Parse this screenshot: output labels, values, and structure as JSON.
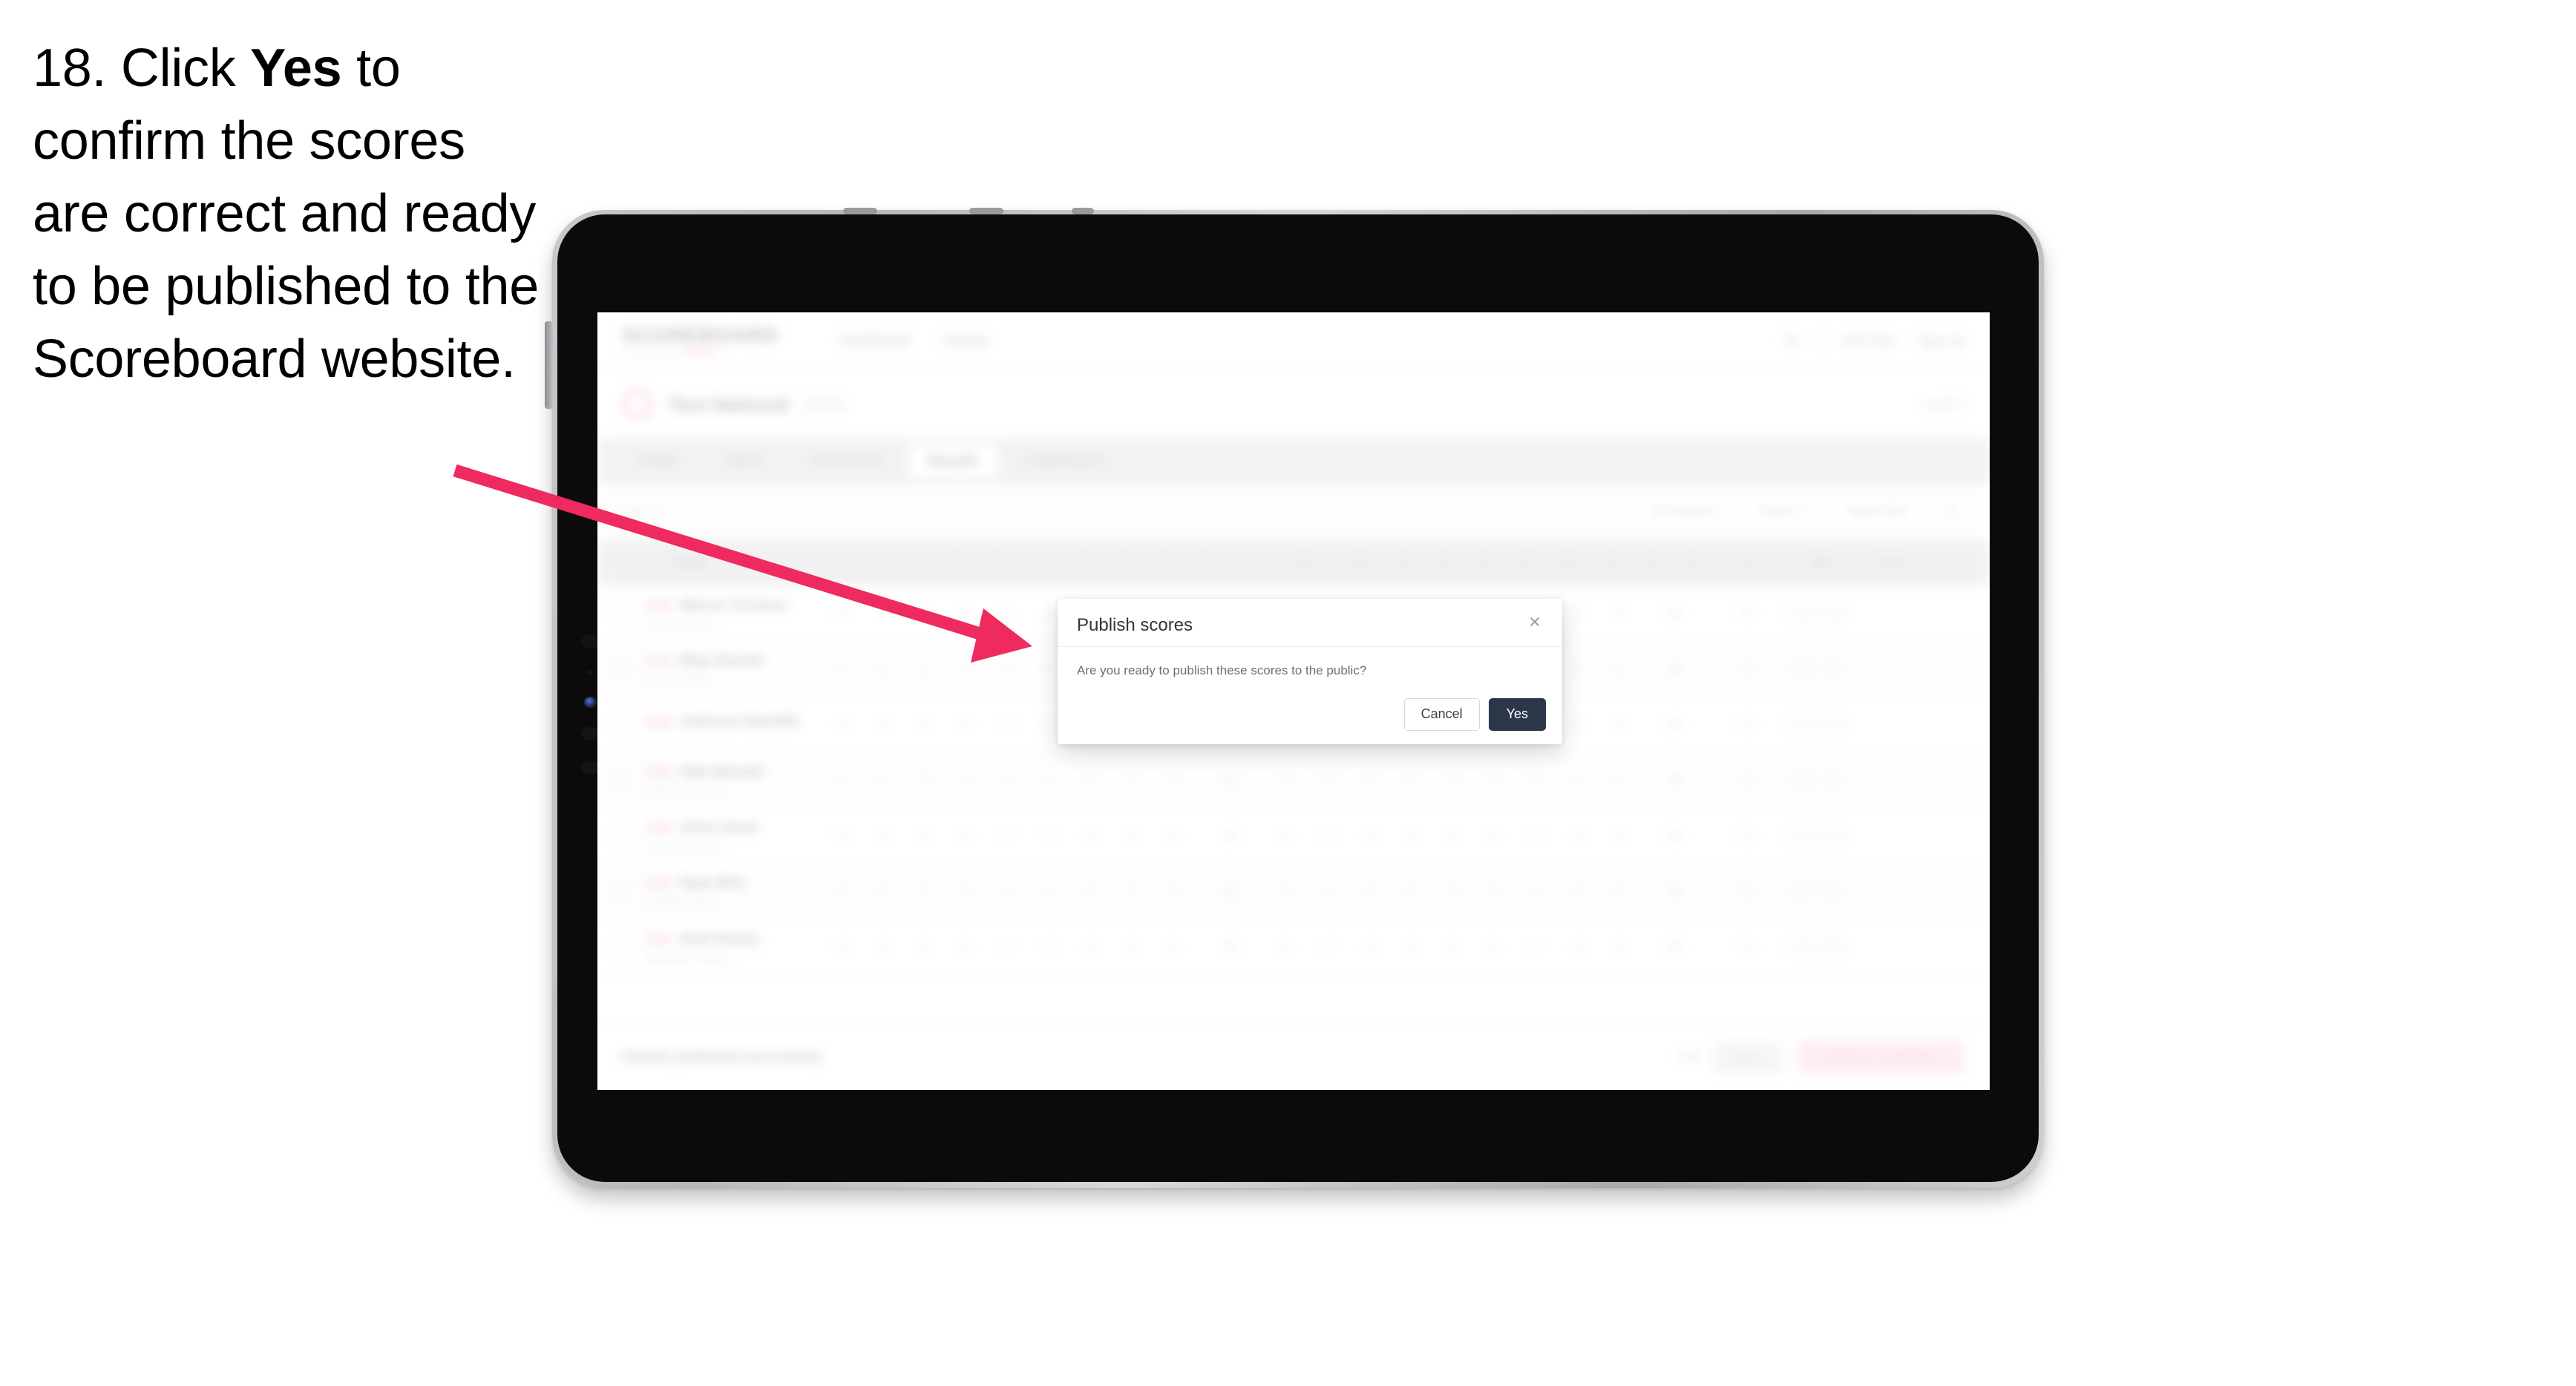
{
  "caption": {
    "step_number": "18.",
    "text_before": "Click",
    "emphasis": "Yes",
    "text_after": "to confirm the scores are correct and ready to be published to the Scoreboard website."
  },
  "modal": {
    "title": "Publish scores",
    "message": "Are you ready to publish these scores to the public?",
    "close_icon": "×",
    "cancel_label": "Cancel",
    "confirm_label": "Yes",
    "confirm_bg": "#2c3649",
    "cancel_border": "#ccd9ef"
  },
  "annotation": {
    "arrow_color": "#ee2a5f",
    "points_to": "Yes"
  },
  "app": {
    "header": {
      "logo": "SCOREBOARD",
      "logo_sub": "POWERED BY",
      "logo_sub_accent": "EVENTS",
      "nav": [
        "Dashboard",
        "Events"
      ],
      "bell_icon": "✉",
      "user": "Test User",
      "sign_out": "Sign out"
    },
    "event": {
      "title": "Test National",
      "subtitle": "2024",
      "right_meta": "Level 3"
    },
    "tabs": [
      {
        "label": "Details"
      },
      {
        "label": "Teams"
      },
      {
        "label": "Score Entry"
      },
      {
        "label": "Results"
      },
      {
        "label": "Leaderboard"
      }
    ],
    "active_tab_index": 3,
    "filter_bar": {
      "search_placeholder": "Search",
      "filters": [
        "All Divisions",
        "Round 1",
        "Apply Filter"
      ]
    },
    "table": {
      "columns": [
        "Player",
        "1",
        "2",
        "3",
        "4",
        "5",
        "6",
        "7",
        "8",
        "9",
        "Out",
        "10",
        "11",
        "12",
        "13",
        "14",
        "15",
        "16",
        "17",
        "18",
        "In",
        "Total",
        "To Par"
      ],
      "rows": [
        {
          "name": "Marcus Torrance",
          "sub": "Thistle Crossing",
          "badge": "AM"
        },
        {
          "name": "Rhys Darnell",
          "sub": "Laurel Hollows",
          "badge": "AM"
        },
        {
          "name": "Cameron Radcliffe",
          "sub": "",
          "badge": "AM"
        },
        {
          "name": "Dale Maxwell",
          "sub": "Kingsmere Country",
          "badge": "AM"
        },
        {
          "name": "Oliver Grant",
          "sub": "Stonebrook Fields",
          "badge": "AM"
        },
        {
          "name": "Ryan Britt",
          "sub": "Northgate Downs",
          "badge": "AM"
        },
        {
          "name": "Nash Easley",
          "sub": "Wrenfield Commons",
          "badge": "AM"
        }
      ]
    },
    "footer": {
      "note": "Results published successfully",
      "link": "Edit",
      "button_secondary": "Save",
      "button_primary": "Publish to Scoreboard"
    }
  }
}
